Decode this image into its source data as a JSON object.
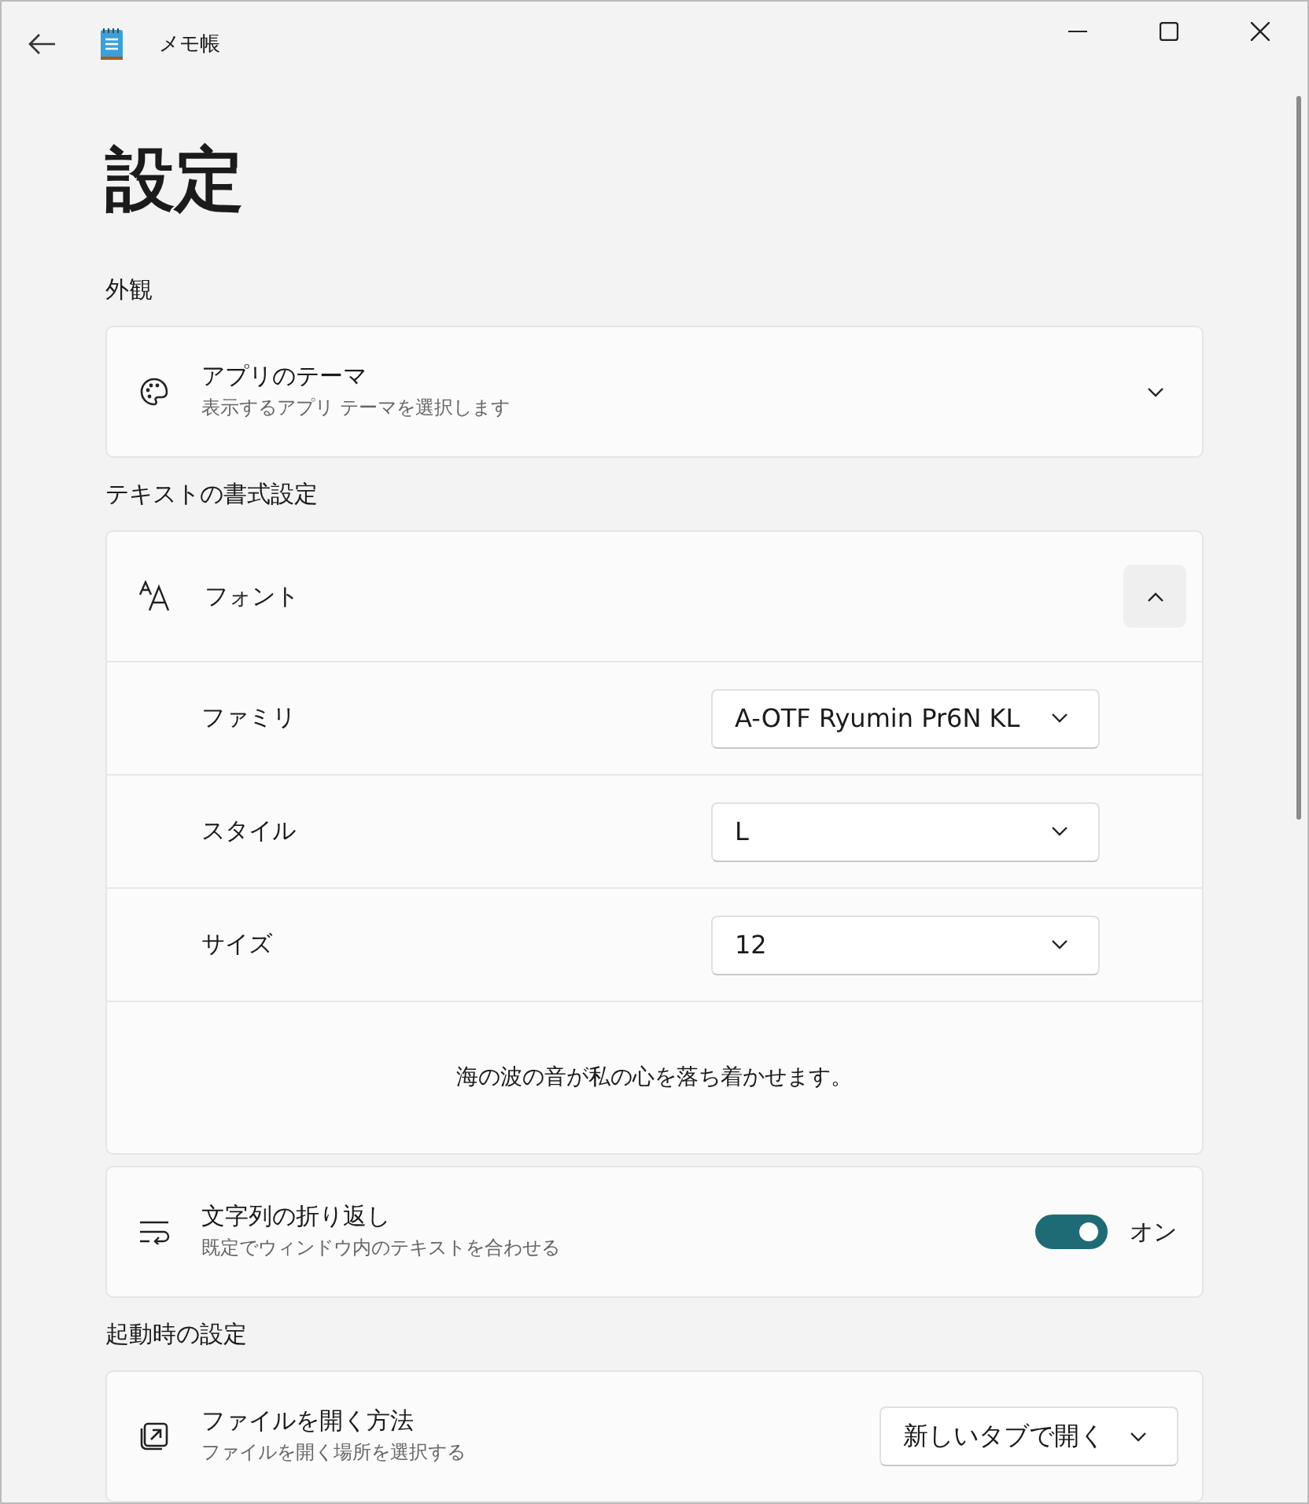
{
  "title_bar": {
    "app_name": "メモ帳"
  },
  "heading": "設定",
  "sections": [
    {
      "title": "外観",
      "cards": [
        {
          "kind": "expander",
          "title": "アプリのテーマ",
          "subtitle": "表示するアプリ テーマを選択します",
          "expanded": false
        }
      ]
    },
    {
      "title": "テキストの書式設定",
      "cards": [
        {
          "kind": "expander",
          "title": "フォント",
          "expanded": true,
          "rows": [
            {
              "label": "ファミリ",
              "value": "A-OTF Ryumin Pr6N KL"
            },
            {
              "label": "スタイル",
              "value": "L"
            },
            {
              "label": "サイズ",
              "value": "12"
            }
          ],
          "preview": "海の波の音が私の心を落ち着かせます。"
        },
        {
          "kind": "toggle",
          "title": "文字列の折り返し",
          "subtitle": "既定でウィンドウ内のテキストを合わせる",
          "on": true,
          "state_label": "オン"
        }
      ]
    },
    {
      "title": "起動時の設定",
      "cards": [
        {
          "kind": "dropdown",
          "title": "ファイルを開く方法",
          "subtitle": "ファイルを開く場所を選択する",
          "value": "新しいタブで開く"
        }
      ]
    }
  ]
}
